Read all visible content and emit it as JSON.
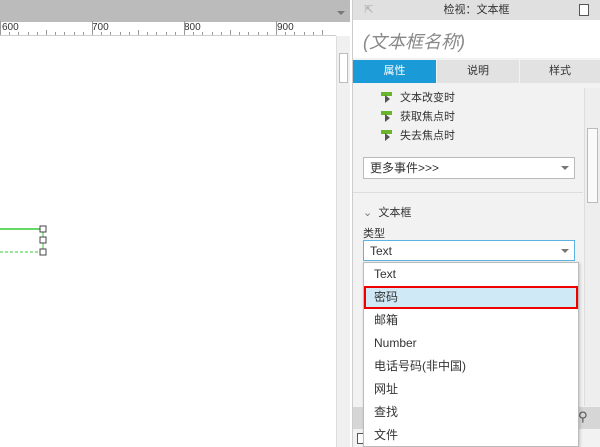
{
  "ruler": {
    "labels": [
      "600",
      "700",
      "800",
      "900"
    ]
  },
  "panel": {
    "title": "检视：文本框",
    "name_placeholder": "(文本框名称)",
    "tabs": [
      {
        "label": "属性",
        "active": true
      },
      {
        "label": "说明"
      },
      {
        "label": "样式"
      }
    ],
    "events": [
      "文本改变时",
      "获取焦点时",
      "失去焦点时"
    ],
    "more_events": "更多事件>>>",
    "section": "文本框",
    "type_label": "类型",
    "type_value": "Text",
    "type_options": [
      "Text",
      "密码",
      "邮箱",
      "Number",
      "电话号码(非中国)",
      "网址",
      "查找",
      "文件"
    ],
    "highlighted_option": "密码"
  },
  "colors": {
    "accent": "#1a9ad6",
    "event_icon": "#6bb52d",
    "highlight": "#cfe9f7",
    "highlight_border": "#e00000"
  }
}
